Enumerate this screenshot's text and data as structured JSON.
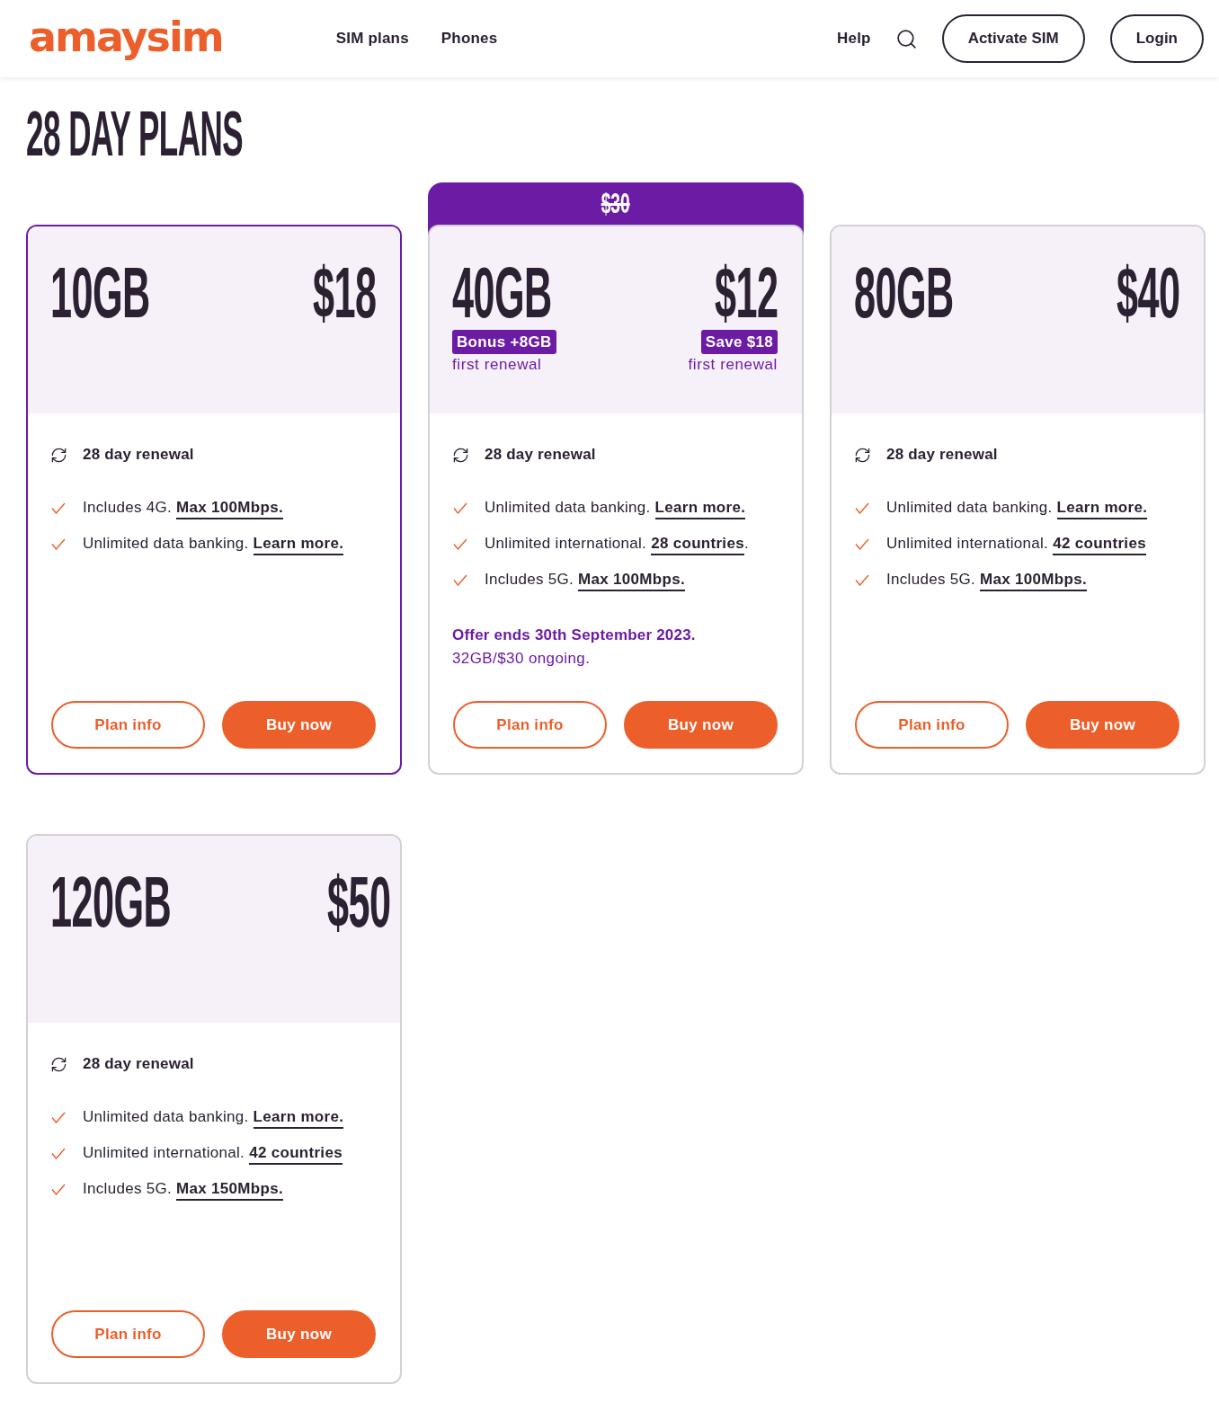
{
  "header": {
    "logo": "amaysim",
    "nav": [
      "SIM plans",
      "Phones"
    ],
    "help": "Help",
    "buttons": [
      "Activate SIM",
      "Login"
    ]
  },
  "title": "28 DAY PLANS",
  "plans": [
    {
      "selected": true,
      "data": "10GB",
      "price": "$18",
      "renewal": "28 day renewal",
      "features": [
        {
          "text": "Includes 4G.",
          "link": "Max 100Mbps."
        },
        {
          "text": "Unlimited data banking.",
          "link": "Learn more."
        }
      ],
      "buttons": [
        {
          "label": "Plan info",
          "kind": "outline"
        },
        {
          "label": "Buy now",
          "kind": "primary"
        }
      ]
    },
    {
      "selected": false,
      "old_price": "$30",
      "data": "40GB",
      "data_tag": "Bonus +8GB",
      "data_note": "first renewal",
      "price": "$12",
      "price_tag": "Save $18",
      "price_note": "first renewal",
      "renewal": "28 day renewal",
      "features": [
        {
          "text": "Unlimited data banking.",
          "link": "Learn more."
        },
        {
          "text": "Unlimited international.",
          "link": "28 countries",
          "after": "."
        },
        {
          "text": "Includes 5G.",
          "link": "Max 100Mbps."
        }
      ],
      "offer": {
        "title": "Offer ends 30th September 2023.",
        "note": "32GB/$30 ongoing."
      },
      "buttons": [
        {
          "label": "Plan info",
          "kind": "outline"
        },
        {
          "label": "Buy now",
          "kind": "primary"
        }
      ]
    },
    {
      "selected": false,
      "data": "80GB",
      "price": "$40",
      "renewal": "28 day renewal",
      "features": [
        {
          "text": "Unlimited data banking.",
          "link": "Learn more."
        },
        {
          "text": "Unlimited international.",
          "link": "42 countries"
        },
        {
          "text": "Includes 5G.",
          "link": "Max 100Mbps."
        }
      ],
      "buttons": [
        {
          "label": "Plan info",
          "kind": "outline"
        },
        {
          "label": "Buy now",
          "kind": "primary"
        }
      ]
    },
    {
      "selected": false,
      "data": "120GB",
      "price": "$50",
      "renewal": "28 day renewal",
      "features": [
        {
          "text": "Unlimited data banking.",
          "link": "Learn more."
        },
        {
          "text": "Unlimited international.",
          "link": "42 countries"
        },
        {
          "text": "Includes 5G.",
          "link": "Max 150Mbps."
        }
      ],
      "buttons": [
        {
          "label": "Plan info",
          "kind": "outline"
        },
        {
          "label": "Buy now",
          "kind": "primary"
        }
      ]
    }
  ]
}
